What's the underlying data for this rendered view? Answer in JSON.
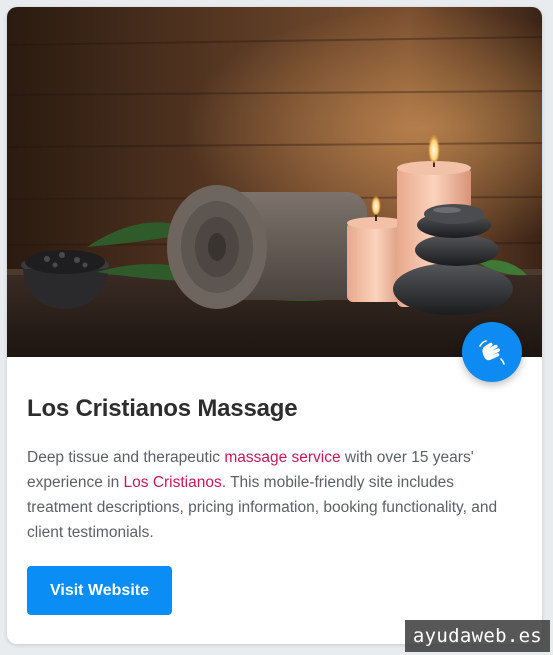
{
  "card": {
    "image_alt": "Spa scene with rolled towel, candles and massage stones",
    "title": "Los Cristianos Massage",
    "description": {
      "part1": "Deep tissue and therapeutic ",
      "link1": "massage service",
      "part2": " with over 15 years' experience in ",
      "link2": "Los Cristianos",
      "part3": ". This mobile-friendly site includes treatment descriptions, pricing information, booking functionality, and client testimonials."
    },
    "button_label": "Visit Website",
    "fab_icon": "hands-icon"
  },
  "watermark": "ayudaweb.es",
  "colors": {
    "accent": "#0a8ef5",
    "link": "#c8185b",
    "title": "#2d2d2d",
    "body_text": "#5c6066"
  }
}
